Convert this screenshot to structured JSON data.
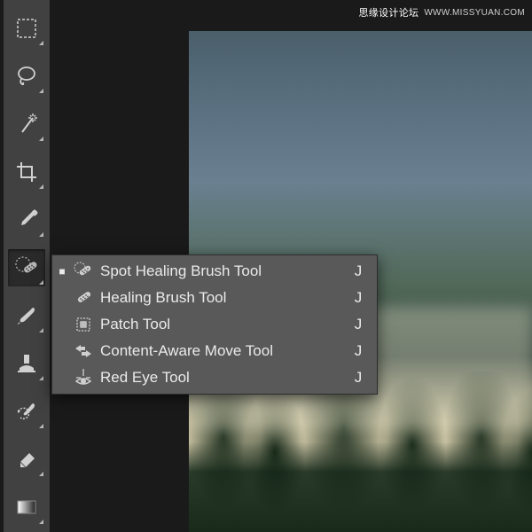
{
  "watermark": {
    "text": "思缘设计论坛",
    "url": "WWW.MISSYUAN.COM"
  },
  "toolbar": {
    "active_index": 5,
    "tools": [
      {
        "id": "marquee",
        "name": "rectangular-marquee-icon"
      },
      {
        "id": "lasso",
        "name": "lasso-icon"
      },
      {
        "id": "wand",
        "name": "magic-wand-icon"
      },
      {
        "id": "crop",
        "name": "crop-icon"
      },
      {
        "id": "eyedropper",
        "name": "eyedropper-icon"
      },
      {
        "id": "healing",
        "name": "spot-healing-brush-icon"
      },
      {
        "id": "brush",
        "name": "brush-icon"
      },
      {
        "id": "stamp",
        "name": "clone-stamp-icon"
      },
      {
        "id": "history",
        "name": "history-brush-icon"
      },
      {
        "id": "eraser",
        "name": "eraser-icon"
      },
      {
        "id": "gradient",
        "name": "gradient-icon"
      }
    ]
  },
  "flyout": {
    "items": [
      {
        "label": "Spot Healing Brush Tool",
        "shortcut": "J",
        "icon": "spot-healing-brush-icon",
        "selected": true
      },
      {
        "label": "Healing Brush Tool",
        "shortcut": "J",
        "icon": "healing-brush-icon",
        "selected": false
      },
      {
        "label": "Patch Tool",
        "shortcut": "J",
        "icon": "patch-icon",
        "selected": false
      },
      {
        "label": "Content-Aware Move Tool",
        "shortcut": "J",
        "icon": "content-aware-move-icon",
        "selected": false
      },
      {
        "label": "Red Eye Tool",
        "shortcut": "J",
        "icon": "red-eye-icon",
        "selected": false
      }
    ]
  }
}
